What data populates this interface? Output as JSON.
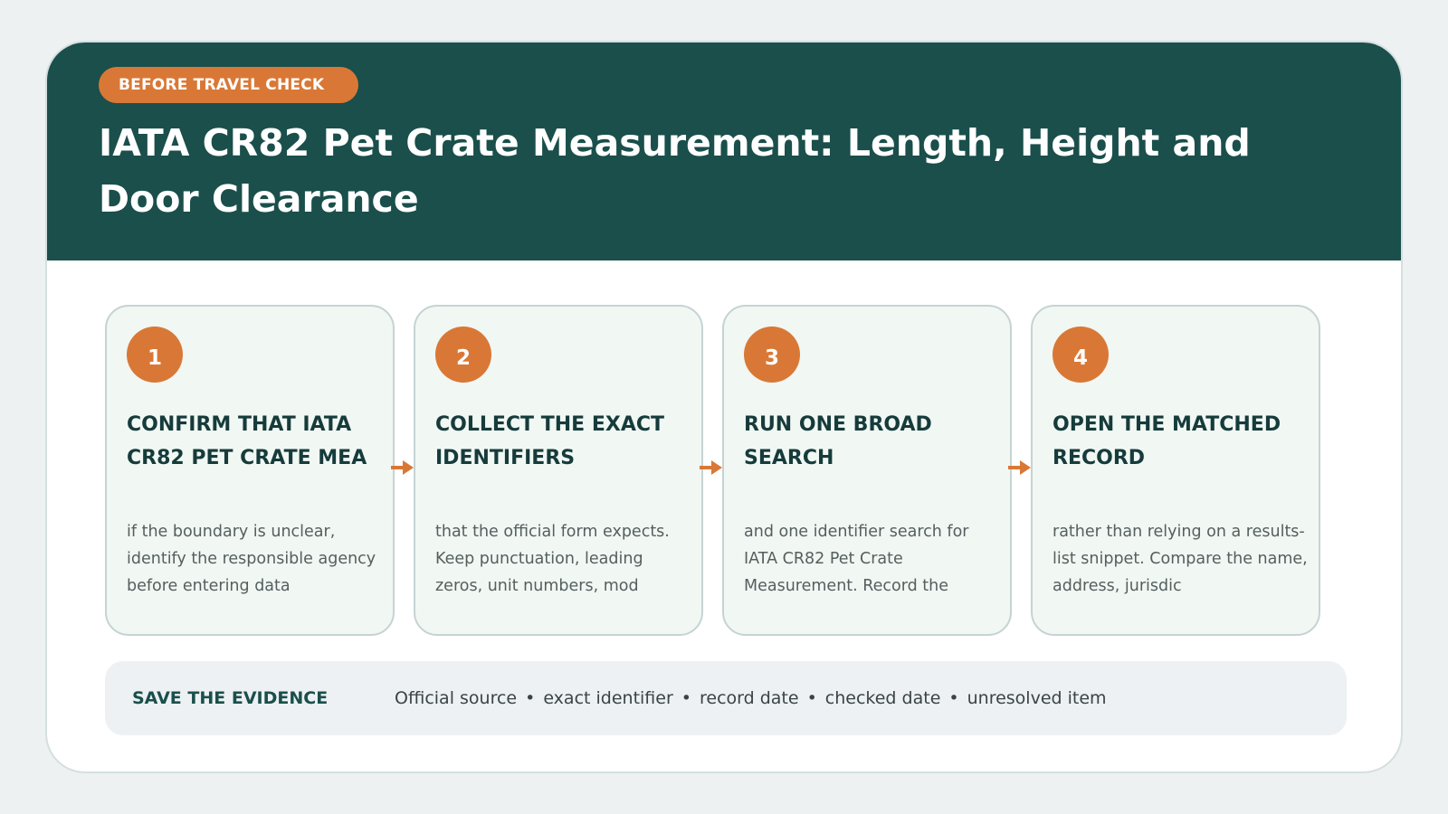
{
  "header": {
    "badge": "BEFORE TRAVEL CHECK",
    "title": "IATA CR82 Pet Crate Measurement: Length, Height and Door Clearance"
  },
  "steps": [
    {
      "number": "1",
      "title": "CONFIRM THAT IATA CR82 PET CRATE MEA",
      "body": "if the boundary is unclear, identify the responsible agency before entering data"
    },
    {
      "number": "2",
      "title": "COLLECT THE EXACT IDENTIFIERS",
      "body": "that the official form expects. Keep punctuation, leading zeros, unit numbers, mod"
    },
    {
      "number": "3",
      "title": "RUN ONE BROAD SEARCH",
      "body": "and one identifier search for IATA CR82 Pet Crate Measurement. Record the"
    },
    {
      "number": "4",
      "title": "OPEN THE MATCHED RECORD",
      "body": "rather than relying on a results-list snippet. Compare the name, address, jurisdic"
    }
  ],
  "evidence": {
    "label": "SAVE THE EVIDENCE",
    "items": [
      "Official source",
      "exact identifier",
      "record date",
      "checked date",
      "unresolved item"
    ],
    "separator": "•"
  },
  "colors": {
    "header_bg": "#1a4f4b",
    "accent": "#d97836",
    "step_bg": "#f1f7f3"
  },
  "icons": {
    "step_connector": "arrow-right-icon"
  }
}
